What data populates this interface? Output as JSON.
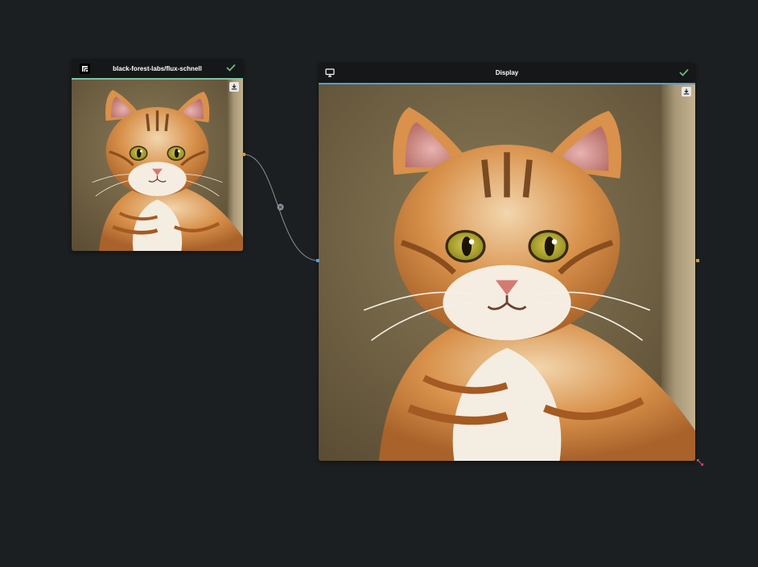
{
  "nodes": {
    "flux": {
      "title": "black-forest-labs/flux-schnell",
      "icon": "flux-model-icon",
      "status": "completed",
      "accent_color": "#7cc4a4",
      "check_color": "#6dbb7e"
    },
    "display": {
      "title": "Display",
      "icon": "monitor-icon",
      "status": "completed",
      "accent_color": "#4aa3d8",
      "check_color": "#6dbb7e"
    }
  },
  "edge": {
    "color": "#8a8f96",
    "output_port_color": "#d49a3a",
    "input_port_color": "#4aa3d8"
  },
  "image": {
    "subject": "tabby cat portrait",
    "download_icon": "download-icon"
  },
  "resize_handle_color": "#e04a7a"
}
